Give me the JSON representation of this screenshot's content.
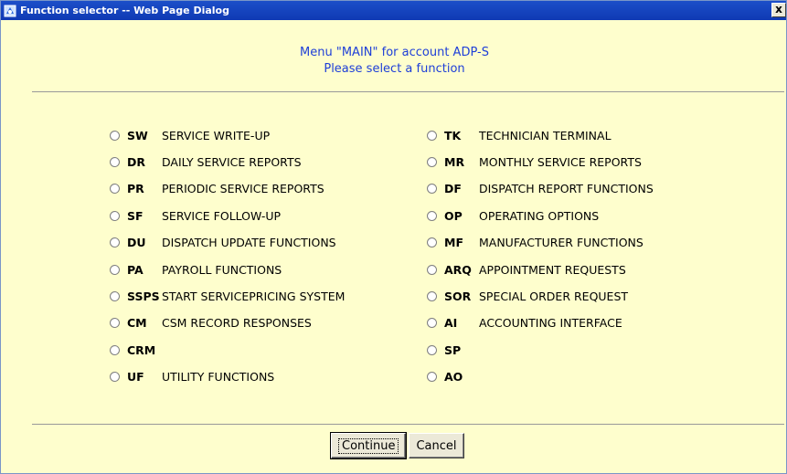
{
  "window": {
    "title": "Function selector -- Web Page Dialog",
    "close_label": "x"
  },
  "header": {
    "line1": "Menu \"MAIN\" for account ADP-S",
    "line2": "Please select a function"
  },
  "left_options": [
    {
      "code": "SW",
      "label": "SERVICE WRITE-UP"
    },
    {
      "code": "DR",
      "label": "DAILY SERVICE REPORTS"
    },
    {
      "code": "PR",
      "label": "PERIODIC SERVICE REPORTS"
    },
    {
      "code": "SF",
      "label": "SERVICE FOLLOW-UP"
    },
    {
      "code": "DU",
      "label": "DISPATCH UPDATE FUNCTIONS"
    },
    {
      "code": "PA",
      "label": "PAYROLL FUNCTIONS"
    },
    {
      "code": "SSPS",
      "label": "START SERVICEPRICING SYSTEM"
    },
    {
      "code": "CM",
      "label": "CSM RECORD RESPONSES"
    },
    {
      "code": "CRM",
      "label": ""
    },
    {
      "code": "UF",
      "label": "UTILITY FUNCTIONS"
    }
  ],
  "right_options": [
    {
      "code": "TK",
      "label": "TECHNICIAN TERMINAL"
    },
    {
      "code": "MR",
      "label": "MONTHLY SERVICE REPORTS"
    },
    {
      "code": "DF",
      "label": "DISPATCH REPORT FUNCTIONS"
    },
    {
      "code": "OP",
      "label": "OPERATING OPTIONS"
    },
    {
      "code": "MF",
      "label": "MANUFACTURER FUNCTIONS"
    },
    {
      "code": "ARQ",
      "label": "APPOINTMENT REQUESTS"
    },
    {
      "code": "SOR",
      "label": "SPECIAL ORDER REQUEST"
    },
    {
      "code": "AI",
      "label": "ACCOUNTING INTERFACE"
    },
    {
      "code": "SP",
      "label": ""
    },
    {
      "code": "AO",
      "label": ""
    }
  ],
  "buttons": {
    "continue": "Continue",
    "cancel": "Cancel"
  }
}
